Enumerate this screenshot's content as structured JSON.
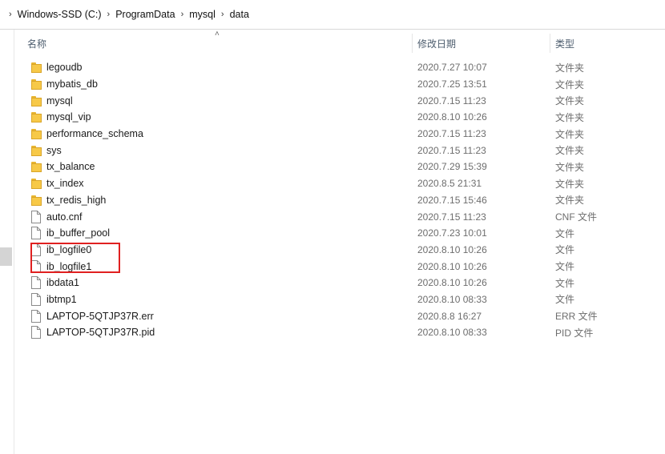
{
  "breadcrumb": [
    "Windows-SSD (C:)",
    "ProgramData",
    "mysql",
    "data"
  ],
  "columns": {
    "name": "名称",
    "date": "修改日期",
    "type": "类型"
  },
  "files": [
    {
      "icon": "folder-icon",
      "name": "legoudb",
      "date": "2020.7.27 10:07",
      "type": "文件夹"
    },
    {
      "icon": "folder-icon",
      "name": "mybatis_db",
      "date": "2020.7.25 13:51",
      "type": "文件夹"
    },
    {
      "icon": "folder-icon",
      "name": "mysql",
      "date": "2020.7.15 11:23",
      "type": "文件夹"
    },
    {
      "icon": "folder-icon",
      "name": "mysql_vip",
      "date": "2020.8.10 10:26",
      "type": "文件夹"
    },
    {
      "icon": "folder-icon",
      "name": "performance_schema",
      "date": "2020.7.15 11:23",
      "type": "文件夹"
    },
    {
      "icon": "folder-icon",
      "name": "sys",
      "date": "2020.7.15 11:23",
      "type": "文件夹"
    },
    {
      "icon": "folder-icon",
      "name": "tx_balance",
      "date": "2020.7.29 15:39",
      "type": "文件夹"
    },
    {
      "icon": "folder-icon",
      "name": "tx_index",
      "date": "2020.8.5 21:31",
      "type": "文件夹"
    },
    {
      "icon": "folder-icon",
      "name": "tx_redis_high",
      "date": "2020.7.15 15:46",
      "type": "文件夹"
    },
    {
      "icon": "file-icon",
      "name": "auto.cnf",
      "date": "2020.7.15 11:23",
      "type": "CNF 文件"
    },
    {
      "icon": "file-icon",
      "name": "ib_buffer_pool",
      "date": "2020.7.23 10:01",
      "type": "文件"
    },
    {
      "icon": "file-icon",
      "name": "ib_logfile0",
      "date": "2020.8.10 10:26",
      "type": "文件"
    },
    {
      "icon": "file-icon",
      "name": "ib_logfile1",
      "date": "2020.8.10 10:26",
      "type": "文件"
    },
    {
      "icon": "file-icon",
      "name": "ibdata1",
      "date": "2020.8.10 10:26",
      "type": "文件"
    },
    {
      "icon": "file-icon",
      "name": "ibtmp1",
      "date": "2020.8.10 08:33",
      "type": "文件"
    },
    {
      "icon": "file-icon",
      "name": "LAPTOP-5QTJP37R.err",
      "date": "2020.8.8 16:27",
      "type": "ERR 文件"
    },
    {
      "icon": "file-icon",
      "name": "LAPTOP-5QTJP37R.pid",
      "date": "2020.8.10 08:33",
      "type": "PID 文件"
    }
  ]
}
